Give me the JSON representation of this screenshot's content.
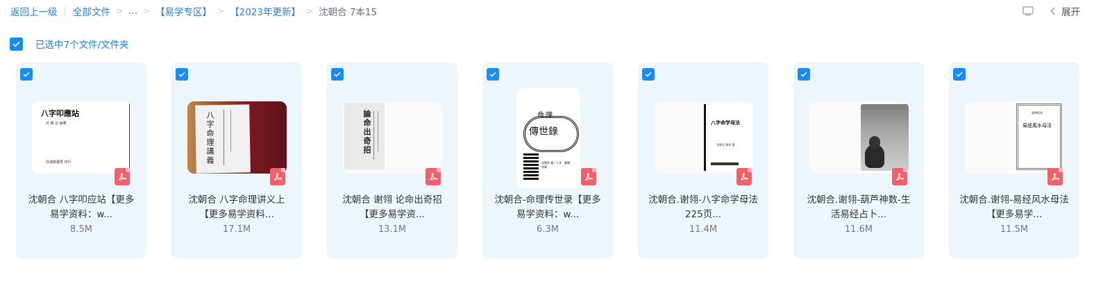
{
  "breadcrumb": {
    "back": "返回上一级",
    "all_files": "全部文件",
    "ellipsis": "...",
    "folder1": "【易学专区】",
    "folder2": "【2023年更新】",
    "current": "沈朝合 7本15"
  },
  "toolbar": {
    "expand_label": "展开"
  },
  "selection": {
    "label": "已选中7个文件/文件夹"
  },
  "thumb_text": {
    "t1_title": "八字叩應站",
    "t1_sub": "沈 朝 合 編著",
    "t1_logo": "交通部書局 印行",
    "t2_title": "八字命理講義",
    "t3_title": "論命出奇招",
    "t4_top": "命理",
    "t4_main": "傳世錄",
    "t4_sub": "沈朝合 著 / 八字 · 紫微 · 命理",
    "t5_title": "八字命学母法",
    "t5_sub": "沈朝合 谢翎 著",
    "t7_top": "國學經典",
    "t7_title": "易經風水母法"
  },
  "files": [
    {
      "title_line1": "沈朝合 八字叩应站【更多",
      "title_line2": "易学资料：w...",
      "size": "8.5M",
      "type": "pdf-icon"
    },
    {
      "title_line1": "沈朝合 八字命理讲义上",
      "title_line2": "【更多易学资料...",
      "size": "17.1M",
      "type": "pdf-icon"
    },
    {
      "title_line1": "沈朝合 谢翎 论命出奇招",
      "title_line2": "【更多易学资...",
      "size": "13.1M",
      "type": "pdf-icon"
    },
    {
      "title_line1": "沈朝合-命理传世录【更多",
      "title_line2": "易学资料：w...",
      "size": "6.3M",
      "type": "pdf-icon"
    },
    {
      "title_line1": "沈朝合.谢翎-八字命学母法",
      "title_line2": "225页...",
      "size": "11.4M",
      "type": "pdf-icon"
    },
    {
      "title_line1": "沈朝合.谢翎-葫芦神数-生",
      "title_line2": "活易经占卜...",
      "size": "11.6M",
      "type": "pdf-icon"
    },
    {
      "title_line1": "沈朝合.谢翎-易经风水母法",
      "title_line2": "【更多易学...",
      "size": "11.5M",
      "type": "pdf-icon"
    }
  ],
  "colors": {
    "accent": "#1a8cf0",
    "link": "#2a7fd4",
    "card_bg": "#eef6fd",
    "pdf": "#f0626b"
  }
}
